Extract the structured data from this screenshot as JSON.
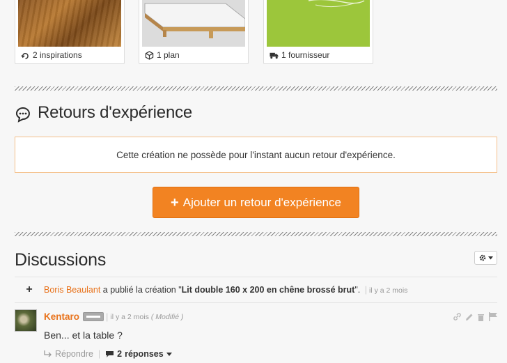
{
  "cards": [
    {
      "icon": "inspiration-icon",
      "label": "2 inspirations"
    },
    {
      "icon": "cube-icon",
      "label": "1 plan"
    },
    {
      "icon": "truck-icon",
      "label": "1 fournisseur"
    }
  ],
  "retours": {
    "title": "Retours d'expérience",
    "notice": "Cette création ne possède pour l'instant aucun retour d'expérience.",
    "add_button": "Ajouter un retour d'expérience"
  },
  "discussions": {
    "title": "Discussions",
    "activity": {
      "author": "Boris Beaulant",
      "text_before": " a publié la création \"",
      "creation": "Lit double 160 x 200 en chêne brossé brut",
      "text_after": "\".",
      "time": "il y a 2 mois"
    },
    "comment": {
      "author": "Kentaro",
      "time": "il y a 2 mois",
      "modified": "( Modifié )",
      "text": "Ben... et la table ?",
      "reply": "Répondre",
      "replies_count": "2",
      "replies_label": "réponses"
    }
  },
  "colors": {
    "accent": "#f28322",
    "link": "#e8731c",
    "notice_border": "#f5c08a"
  }
}
